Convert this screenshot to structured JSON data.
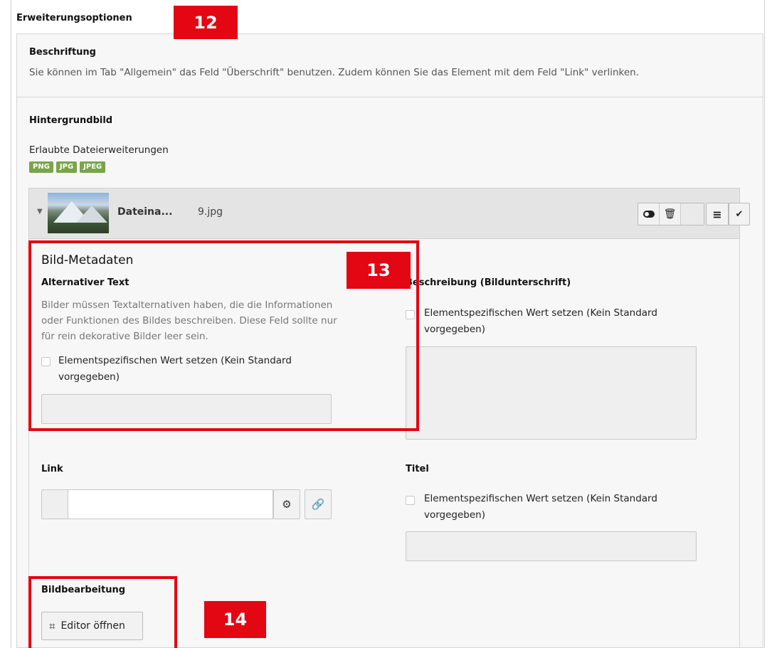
{
  "section": {
    "title": "Erweiterungsoptionen"
  },
  "caption": {
    "label": "Beschriftung",
    "help": "Sie können im Tab \"Allgemein\" das Feld \"Überschrift\" benutzen. Zudem können Sie das Element mit dem Feld \"Link\" verlinken."
  },
  "background": {
    "label": "Hintergrundbild",
    "allowed_label": "Erlaubte Dateierweiterungen",
    "extensions": [
      "PNG",
      "JPG",
      "JPEG"
    ]
  },
  "file": {
    "name_label": "Dateina...",
    "name_value": "9.jpg",
    "actions": [
      "toggle-icon",
      "trash-icon",
      "menu-icon",
      "check-icon"
    ]
  },
  "metadata": {
    "title": "Bild-Metadaten",
    "alt": {
      "label": "Alternativer Text",
      "help_line1": "Bilder müssen Textalternativen haben, die die Informationen",
      "help_line2": "oder Funktionen des Bildes beschreiben. Diese Feld sollte nur",
      "help_line3": "für rein dekorative Bilder leer sein.",
      "checkbox_line1": "Elementspezifischen Wert setzen (Kein Standard",
      "checkbox_line2": "vorgegeben)",
      "value": ""
    },
    "description": {
      "label": "Beschreibung (Bildunterschrift)",
      "checkbox_line1": "Elementspezifischen Wert setzen (Kein Standard",
      "checkbox_line2": "vorgegeben)",
      "value": ""
    },
    "link": {
      "label": "Link",
      "value": ""
    },
    "title_field": {
      "label": "Titel",
      "checkbox_line1": "Elementspezifischen Wert setzen (Kein Standard",
      "checkbox_line2": "vorgegeben)",
      "value": ""
    }
  },
  "editing": {
    "label": "Bildbearbeitung",
    "button_label": "Editor öffnen"
  },
  "annotations": [
    "12",
    "13",
    "14"
  ],
  "colors": {
    "annotation_red": "#e30613",
    "badge_green": "#79a548"
  }
}
